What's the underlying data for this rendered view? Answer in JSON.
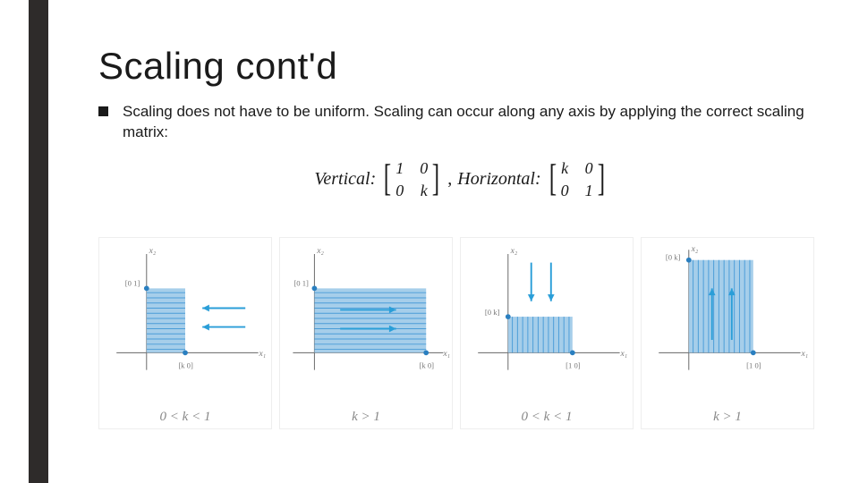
{
  "title": "Scaling cont'd",
  "bullet": "Scaling does not have to be uniform.  Scaling can occur along any axis by applying the correct scaling matrix:",
  "matrices": {
    "vertical_label": "Vertical:",
    "horizontal_label": "Horizontal:",
    "sep": ",",
    "vertical": {
      "r1c1": "1",
      "r1c2": "0",
      "r2c1": "0",
      "r2c2": "k"
    },
    "horizontal": {
      "r1c1": "k",
      "r1c2": "0",
      "r2c1": "0",
      "r2c2": "1"
    }
  },
  "axes": {
    "x": "x₁",
    "y": "x₂"
  },
  "figs": [
    {
      "caption": "0 < k < 1",
      "type": "h-shrink",
      "top_vec": "[0 1]",
      "side_vec": "[k 0]"
    },
    {
      "caption": "k > 1",
      "type": "h-stretch",
      "top_vec": "[0 1]",
      "side_vec": "[k 0]"
    },
    {
      "caption": "0 < k < 1",
      "type": "v-shrink",
      "top_vec": "[0 k]",
      "side_vec": "[1 0]"
    },
    {
      "caption": "k > 1",
      "type": "v-stretch",
      "top_vec": "[0 k]",
      "side_vec": "[1 0]"
    }
  ]
}
